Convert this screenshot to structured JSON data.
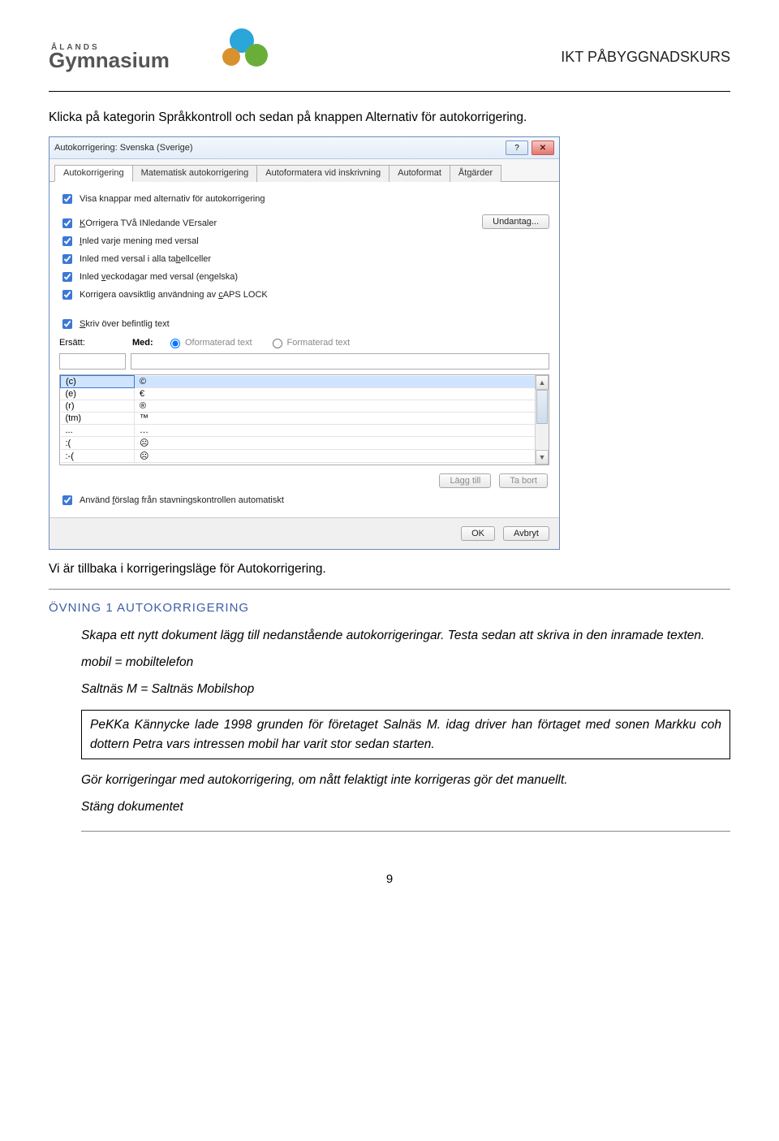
{
  "header": {
    "logo_small": "ÅLANDS",
    "logo_big": "Gymnasium",
    "doc_title": "IKT PÅBYGGNADSKURS"
  },
  "intro": "Klicka på kategorin Språkkontroll och sedan på knappen Alternativ för autokorrigering.",
  "dialog": {
    "title": "Autokorrigering: Svenska (Sverige)",
    "help": "?",
    "close": "✕",
    "tabs": {
      "t1": "Autokorrigering",
      "t2": "Matematisk autokorrigering",
      "t3": "Autoformatera vid inskrivning",
      "t4": "Autoformat",
      "t5": "Åtgärder"
    },
    "checks": {
      "c0": "Visa knappar med alternativ för autokorrigering",
      "c1_pre": "K",
      "c1_rest": "Orrigera TVå INledande VErsaler",
      "c2_pre": "I",
      "c2_rest": "nled varje mening med versal",
      "c3_pre": "Inled med versal i alla ta",
      "c3_u": "b",
      "c3_rest": "ellceller",
      "c4_pre": "Inled ",
      "c4_u": "v",
      "c4_rest": "eckodagar med versal (engelska)",
      "c5_pre": "Korrigera oavsiktlig användning av ",
      "c5_u": "c",
      "c5_rest": "APS LOCK",
      "c6_u": "S",
      "c6_rest": "kriv över befintlig text",
      "c7_u": "f",
      "c7_pre": "Använd ",
      "c7_rest": "örslag från stavningskontrollen automatiskt"
    },
    "undantag": "Undantag...",
    "replace": {
      "label_pre": "E",
      "label_u": "r",
      "label_rest": "sätt:",
      "with_label": "Med:",
      "radio1": "Oformaterad text",
      "radio2": "Formaterad text"
    },
    "list": [
      {
        "from": "(c)",
        "to": "©"
      },
      {
        "from": "(e)",
        "to": "€"
      },
      {
        "from": "(r)",
        "to": "®"
      },
      {
        "from": "(tm)",
        "to": "™"
      },
      {
        "from": "...",
        "to": "…"
      },
      {
        "from": ":(",
        "to": "☹"
      },
      {
        "from": ":-(",
        "to": "☹"
      }
    ],
    "add": "Lägg till",
    "remove": "Ta bort",
    "ok": "OK",
    "cancel": "Avbryt"
  },
  "after_dialog": "Vi är tillbaka i korrigeringsläge för Autokorrigering.",
  "exercise": {
    "title": "ÖVNING 1 AUTOKORRIGERING",
    "p1": "Skapa ett nytt dokument lägg till nedanstående autokorrigeringar. Testa sedan att skriva in den inramade texten.",
    "p2": "mobil  =  mobiltelefon",
    "p3": "Saltnäs M = Saltnäs Mobilshop",
    "boxed": "PeKKa Kännycke lade 1998 grunden för företaget Salnäs M. idag driver han förtaget med sonen Markku coh dottern Petra vars intressen mobil har varit stor sedan starten.",
    "p4": "Gör korrigeringar med autokorrigering, om nått felaktigt inte korrigeras gör det manuellt.",
    "p5": "Stäng dokumentet"
  },
  "page_number": "9"
}
